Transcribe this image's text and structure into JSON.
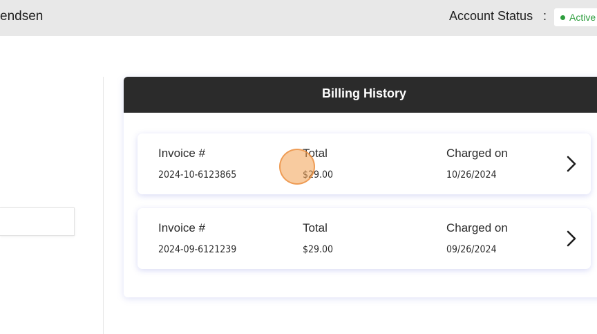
{
  "header": {
    "user_name": "endsen",
    "account_status_label": "Account Status",
    "separator": ":",
    "status_value": "Active",
    "status_color": "#2e9e3e"
  },
  "billing": {
    "title": "Billing History",
    "invoices": [
      {
        "invoice_label": "Invoice #",
        "invoice_number": "2024-10-6123865",
        "total_label": "Total",
        "total": "$29.00",
        "charged_label": "Charged on",
        "charged_on": "10/26/2024"
      },
      {
        "invoice_label": "Invoice #",
        "invoice_number": "2024-09-6121239",
        "total_label": "Total",
        "total": "$29.00",
        "charged_label": "Charged on",
        "charged_on": "09/26/2024"
      }
    ]
  },
  "icons": {
    "row_arrow": "chevron-right-icon",
    "status_indicator": "status-dot-icon"
  }
}
